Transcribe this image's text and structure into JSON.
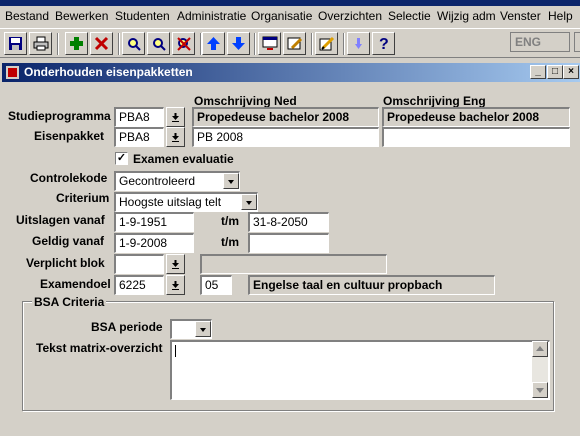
{
  "menu": [
    "Bestand",
    "Bewerken",
    "Studenten",
    "Administratie",
    "Organisatie",
    "Overzichten",
    "Selectie",
    "Wijzig adm",
    "Venster",
    "Help"
  ],
  "language": "ENG",
  "window": {
    "title": "Onderhouden eisenpakketten"
  },
  "form": {
    "headers": {
      "omschrijving_ned": "Omschrijving Ned",
      "omschrijving_eng": "Omschrijving Eng"
    },
    "studieprogramma": {
      "label": "Studieprogramma",
      "code": "PBA8",
      "ned": "Propedeuse bachelor 2008",
      "eng": "Propedeuse bachelor 2008"
    },
    "eisenpakket": {
      "label": "Eisenpakket",
      "code": "PBA8",
      "ned": "PB 2008",
      "eng": ""
    },
    "examen_evaluatie": {
      "label": "Examen evaluatie",
      "checked": true
    },
    "controlekode": {
      "label": "Controlekode",
      "value": "Gecontroleerd"
    },
    "criterium": {
      "label": "Criterium",
      "value": "Hoogste uitslag telt"
    },
    "uitslagen_vanaf": {
      "label": "Uitslagen vanaf",
      "from": "1-9-1951",
      "tm": "t/m",
      "to": "31-8-2050"
    },
    "geldig_vanaf": {
      "label": "Geldig vanaf",
      "from": "1-9-2008",
      "tm": "t/m",
      "to": ""
    },
    "verplicht_blok": {
      "label": "Verplicht blok",
      "value": "",
      "desc": ""
    },
    "examendoel": {
      "label": "Examendoel",
      "code": "6225",
      "num": "05",
      "desc": "Engelse taal en cultuur propbach"
    }
  },
  "bsa": {
    "title": "BSA Criteria",
    "periode": {
      "label": "BSA periode",
      "value": ""
    },
    "tekst": {
      "label": "Tekst matrix-overzicht",
      "value": ""
    }
  }
}
